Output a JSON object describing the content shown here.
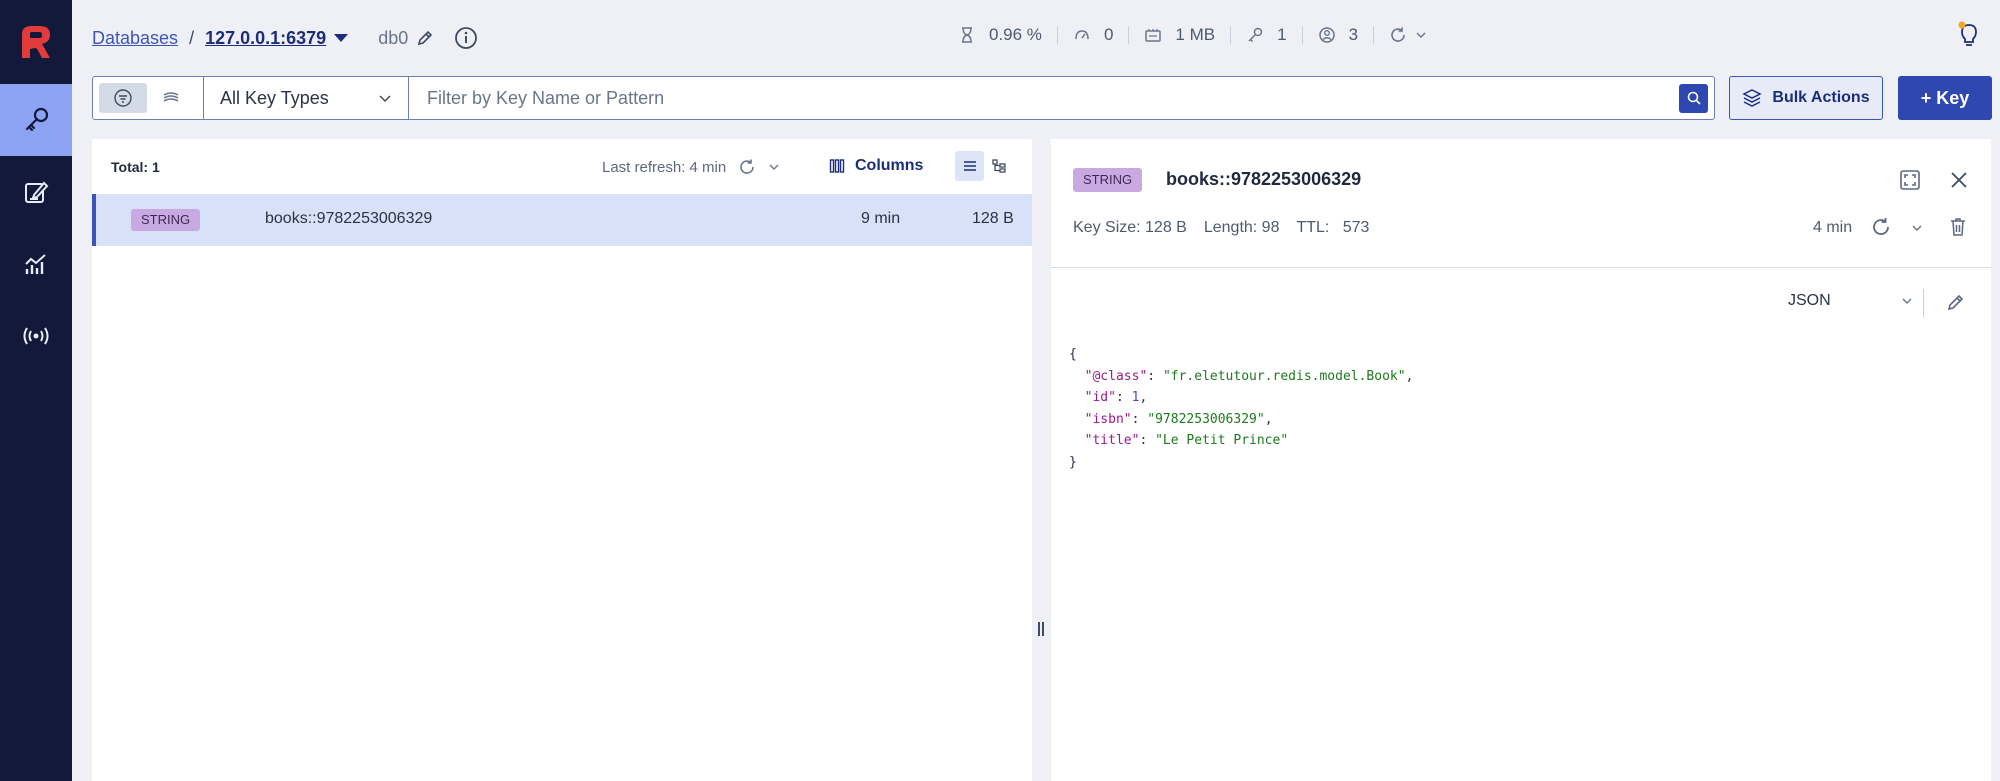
{
  "header": {
    "databases_label": "Databases",
    "separator": "/",
    "host": "127.0.0.1:6379",
    "db_name": "db0",
    "stats": {
      "cpu": "0.96 %",
      "ops": "0",
      "memory": "1 MB",
      "keys": "1",
      "clients": "3"
    }
  },
  "filter": {
    "key_type": "All Key Types",
    "search_placeholder": "Filter by Key Name or Pattern",
    "bulk_actions_label": "Bulk Actions",
    "add_key_label": "+ Key"
  },
  "key_list": {
    "total_label": "Total: 1",
    "last_refresh": "Last refresh: 4 min",
    "columns_label": "Columns",
    "rows": [
      {
        "type": "STRING",
        "key": "books::9782253006329",
        "ttl": "9 min",
        "size": "128 B"
      }
    ]
  },
  "details": {
    "type": "STRING",
    "key": "books::9782253006329",
    "key_size": "Key Size: 128 B",
    "length": "Length: 98",
    "ttl_label": "TTL:",
    "ttl_value": "573",
    "age": "4 min",
    "format": "JSON",
    "json_lines": {
      "open": "{",
      "class_key": "\"@class\"",
      "class_val": "\"fr.eletutour.redis.model.Book\"",
      "id_key": "\"id\"",
      "id_val": "1",
      "isbn_key": "\"isbn\"",
      "isbn_val": "\"9782253006329\"",
      "title_key": "\"title\"",
      "title_val": "\"Le Petit Prince\"",
      "close": "}"
    }
  },
  "colors": {
    "sidebar_bg": "#12193a",
    "sidebar_active": "#8ba3f2",
    "primary": "#2f47b0",
    "badge_string": "#c9a9e2",
    "selected_row": "#d7e1f7"
  }
}
